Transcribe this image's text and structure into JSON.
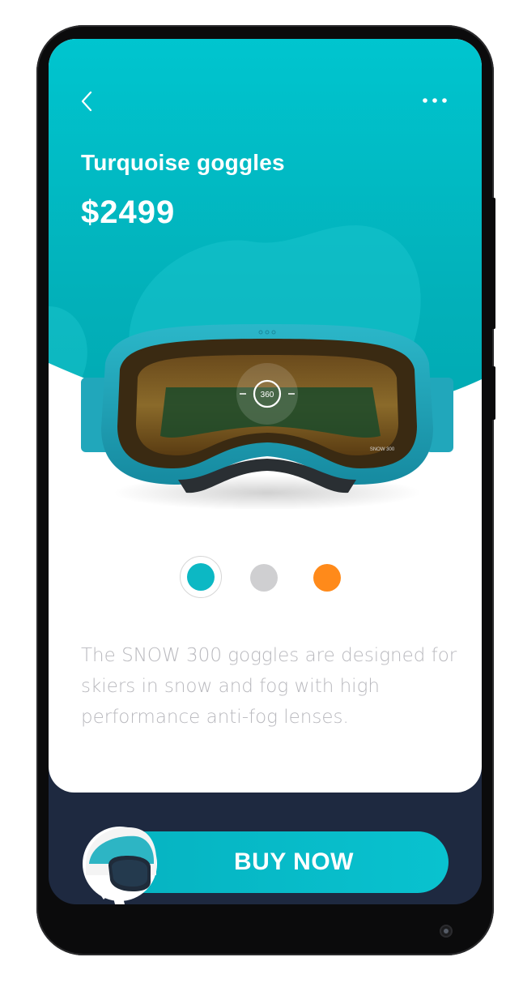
{
  "header": {
    "back_icon": "chevron-left-icon",
    "more_icon": "more-horizontal-icon"
  },
  "product": {
    "title": "Turquoise goggles",
    "price": "$2499",
    "view_badge": "360",
    "brand_mark": "SNOW 300",
    "description": "The SNOW 300 goggles are designed for skiers in snow and fog with high performance anti-fog lenses."
  },
  "colors": {
    "selected": "teal",
    "options": [
      {
        "name": "teal",
        "hex": "#0cb8c4"
      },
      {
        "name": "grey",
        "hex": "#cfcfd1"
      },
      {
        "name": "orange",
        "hex": "#ff8a1a"
      }
    ],
    "accent": "#00c5cf",
    "bottom_bar": "#1e2940"
  },
  "cta": {
    "label": "BUY NOW",
    "icon": "helmet-icon"
  }
}
